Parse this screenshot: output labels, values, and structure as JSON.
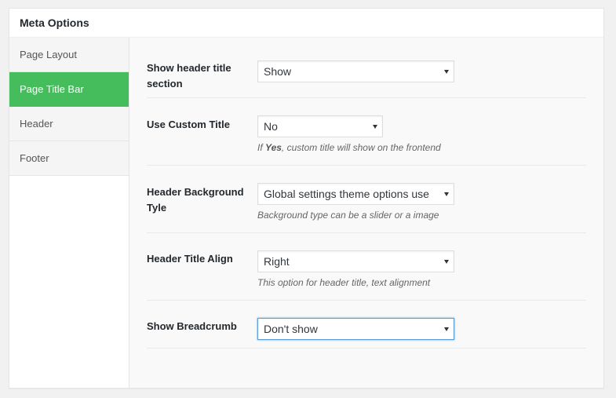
{
  "metabox": {
    "title": "Meta Options"
  },
  "tabs": [
    {
      "label": "Page Layout",
      "active": false
    },
    {
      "label": "Page Title Bar",
      "active": true
    },
    {
      "label": "Header",
      "active": false
    },
    {
      "label": "Footer",
      "active": false
    }
  ],
  "fields": {
    "show_header_title": {
      "label": "Show header title section",
      "value": "Show"
    },
    "use_custom_title": {
      "label": "Use Custom Title",
      "value": "No",
      "desc_prefix": "If ",
      "desc_emphasis": "Yes",
      "desc_suffix": ", custom title will show on the frontend"
    },
    "header_background_type": {
      "label": "Header Background Tyle",
      "value": "Global settings theme options use",
      "desc": "Background type can be a slider or a image"
    },
    "header_title_align": {
      "label": "Header Title Align",
      "value": "Right",
      "desc": "This option for header title, text alignment"
    },
    "show_breadcrumb": {
      "label": "Show Breadcrumb",
      "value": "Don't show"
    }
  },
  "colors": {
    "active_tab": "#46bd5c",
    "focus_border": "#5b9dd9"
  },
  "icons": {
    "dropdown": "chevron-down-icon"
  }
}
